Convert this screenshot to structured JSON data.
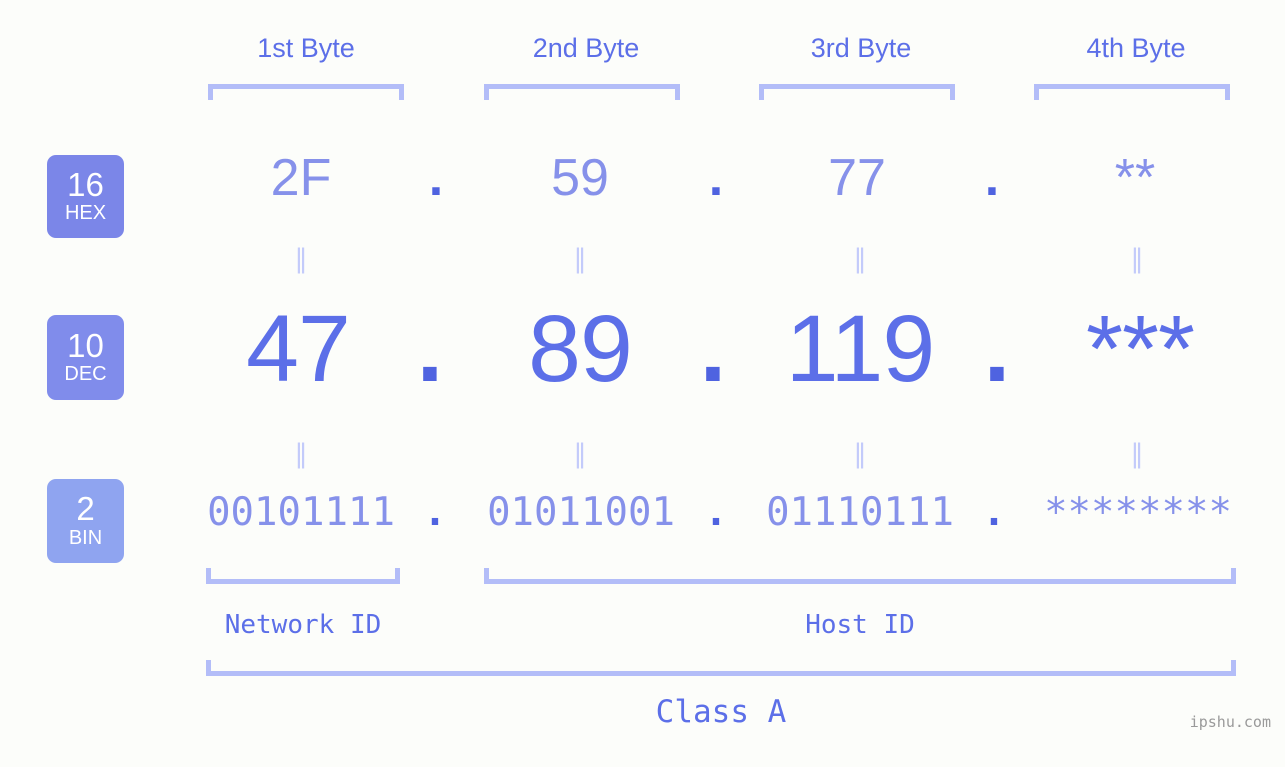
{
  "page": {
    "background_color": "#fcfdfa",
    "watermark": "ipshu.com",
    "class_label": "Class A"
  },
  "colors": {
    "accent_strong": "#5c6fe8",
    "accent_light": "#8691ea",
    "bracket": "#b3bdf8",
    "separator": "#c3cbfa",
    "badge_hex": "#7b86e8",
    "badge_dec": "#808ceb",
    "badge_bin": "#8fa4f0"
  },
  "byte_headers": [
    {
      "label": "1st Byte"
    },
    {
      "label": "2nd Byte"
    },
    {
      "label": "3rd Byte"
    },
    {
      "label": "4th Byte"
    }
  ],
  "radix_badges": [
    {
      "number": "16",
      "name": "HEX"
    },
    {
      "number": "10",
      "name": "DEC"
    },
    {
      "number": "2",
      "name": "BIN"
    }
  ],
  "rows": {
    "hex": {
      "radix": "16",
      "radix_name": "HEX",
      "values": [
        "2F",
        "59",
        "77",
        "**"
      ],
      "separator": "."
    },
    "dec": {
      "radix": "10",
      "radix_name": "DEC",
      "values": [
        "47",
        "89",
        "119",
        "***"
      ],
      "separator": "."
    },
    "bin": {
      "radix": "2",
      "radix_name": "BIN",
      "values": [
        "00101111",
        "01011001",
        "01110111",
        "********"
      ],
      "separator": "."
    }
  },
  "equals_marks": {
    "glyph": "‖",
    "count_per_row": 4
  },
  "id_sections": [
    {
      "label": "Network ID"
    },
    {
      "label": "Host ID"
    }
  ]
}
